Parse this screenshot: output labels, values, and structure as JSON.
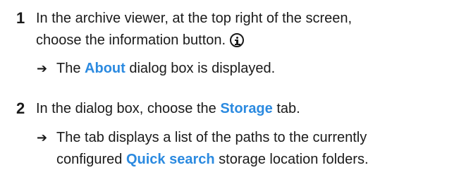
{
  "steps": [
    {
      "number": "1",
      "text_line1": "In the archive viewer, at the top right of the screen,",
      "text_line2": "choose the information button.",
      "icon": "info-circle-icon",
      "result": {
        "arrow": "➔",
        "before": "The ",
        "term": "About",
        "after": " dialog box is displayed."
      }
    },
    {
      "number": "2",
      "text_before": "In the dialog box, choose the ",
      "text_term": "Storage",
      "text_after": " tab.",
      "result": {
        "arrow": "➔",
        "line1": "The tab displays a list of the paths to the currently",
        "line2_before": "configured ",
        "line2_term": "Quick search",
        "line2_after": " storage location folders."
      }
    }
  ],
  "colors": {
    "text": "#1a1a1a",
    "ui_term": "#2b8ae0",
    "background": "#ffffff"
  }
}
